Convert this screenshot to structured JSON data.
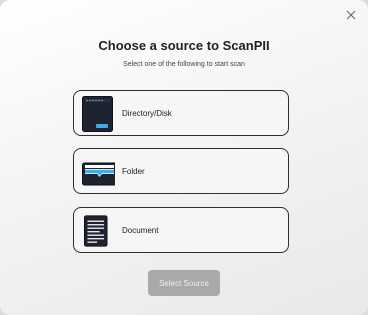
{
  "dialog": {
    "title": "Choose a source to ScanPII",
    "subtitle": "Select one of the following to start scan",
    "options": [
      {
        "label": "Directory/Disk",
        "icon": "disk-icon"
      },
      {
        "label": "Folder",
        "icon": "folder-icon"
      },
      {
        "label": "Document",
        "icon": "document-icon"
      }
    ],
    "submit_label": "Select Source",
    "close_icon": "close-icon"
  },
  "colors": {
    "icon_dark": "#1f2330",
    "accent_blue": "#3bb0e8",
    "button_disabled": "#a9a9a9"
  }
}
